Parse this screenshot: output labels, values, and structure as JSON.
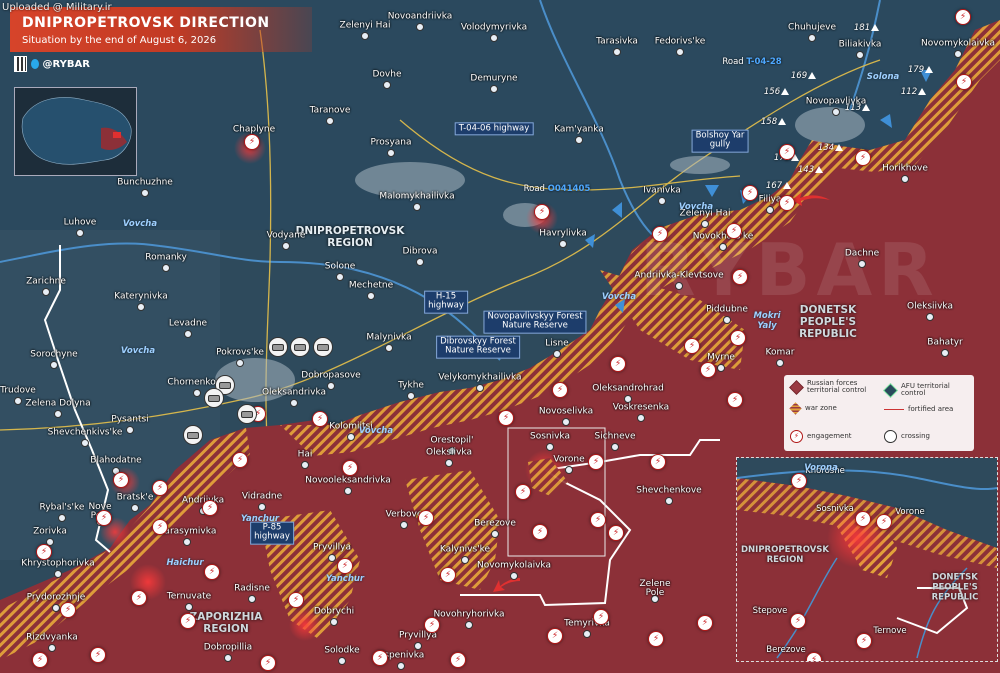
{
  "upload_note": "Uploaded @ Military.ir",
  "header": {
    "title": "DNIPROPETROVSK DIRECTION",
    "subtitle": "Situation by the end of August 6, 2026"
  },
  "brand": {
    "handle": "@RYBAR",
    "icons": [
      "qr-code-icon",
      "telegram-icon"
    ]
  },
  "colors": {
    "afu_territory": "#2e4a5c",
    "russian_territory": "#8c3038",
    "war_zone_stripe": "#e2a23a",
    "header_red": "#d6442a",
    "river": "#4a8ec9",
    "road_yellow": "#e7c14a",
    "engagement": "#c8181c"
  },
  "regions": [
    {
      "id": "dnipropetrovsk",
      "text": "DNIPROPETROVSK\nREGION"
    },
    {
      "id": "donetsk",
      "text": "DONETSK\nPEOPLE'S\nREPUBLIC"
    },
    {
      "id": "zaporizhia",
      "text": "ZAPORIZHIA\nREGION"
    }
  ],
  "settlements": [
    "Zelenyi Hai",
    "Novoandriivka",
    "Volodymyrivka",
    "Tarasivka",
    "Fedorivs'ke",
    "Chuhujeve",
    "Biliakivka",
    "Novomykolaivka",
    "Dovhe",
    "Demurynе",
    "Taranove",
    "Chaplyne",
    "Prosyana",
    "Kam'yanka",
    "Novopavlivka",
    "Bunchuzhne",
    "Malomykhailivka",
    "Ivanivka",
    "Filiya",
    "Horikhove",
    "Luhove",
    "Vodyane",
    "Havrylivka",
    "Zelenyi Hai",
    "Novokhats'ke",
    "Romanky",
    "Solone",
    "Dibrova",
    "Dachne",
    "Zarichne",
    "Mechetne",
    "Andriivka-Klevtsove",
    "Katerynivka",
    "Oleksiivka",
    "Levadne",
    "Piddubne",
    "Bahatyr",
    "Sorochyne",
    "Malynivka",
    "Pokrovs'ke",
    "Lisne",
    "Myrne",
    "Komar",
    "Trudove",
    "Chornenkove",
    "Dobropasove",
    "Velykomykhailivka",
    "Zelena Dolyna",
    "Oleksandrivka",
    "Tykhe",
    "Oleksandrohrad",
    "Pysantsi",
    "Kolomiitsi",
    "Orestopil'",
    "Novoselivka",
    "Voskresenka",
    "Shevchenkivs'ke",
    "Sosnivka",
    "Sichneve",
    "Hai",
    "Blahodatne",
    "Oleksiivka",
    "Vorone",
    "Novooleksandrivka",
    "Shevchenkove",
    "Bratsk'e",
    "Andriivka",
    "Vidradne",
    "Rybal's'ke",
    "Nove\nPole",
    "Verbove",
    "Berezove",
    "Harasymivka",
    "Zorivka",
    "Kalynivs'ke",
    "Pryvillya",
    "Khrystophorivka",
    "Novomykolaivka",
    "Radisne",
    "Ternuvate",
    "Zelene\nPole",
    "Prydorozhnje",
    "Dobrychi",
    "Novohryhorivka",
    "Temyrivka",
    "Rizdvyanka",
    "Pryvillya",
    "Dobropillia",
    "Solodke",
    "Uspenivka"
  ],
  "rivers": [
    "Vovcha",
    "Vovcha",
    "Vovcha",
    "Vovcha",
    "Vovcha",
    "Mokri\nYaly",
    "Yanchur",
    "Yanchur",
    "Haichur",
    "Solona",
    "Vorona"
  ],
  "roads": [
    {
      "prefix": "Road ",
      "code": "T-04-28"
    },
    {
      "prefix": "Road ",
      "code": "O041405"
    }
  ],
  "road_boxes": [
    "T-04-06 highway",
    "Bolshoy Yar\ngully",
    "H-15\nhighway",
    "P-85\nhighway"
  ],
  "forest_labels": [
    "Novopavlivskyy Forest\nNature Reserve",
    "Dibrovskyy Forest\nNature Reserve"
  ],
  "heights": [
    "181",
    "179",
    "169",
    "156",
    "112",
    "158",
    "113",
    "172",
    "134",
    "143",
    "167"
  ],
  "legend": {
    "items": [
      {
        "icon": "russian-control-swatch",
        "label": "Russian forces\nterritorial control"
      },
      {
        "icon": "afu-control-swatch",
        "label": "AFU territorial control"
      },
      {
        "icon": "war-zone-swatch",
        "label": "war zone"
      },
      {
        "icon": "fortified-area-line",
        "label": "fortified area"
      },
      {
        "icon": "engagement-icon",
        "label": "engagement"
      },
      {
        "icon": "crossing-icon",
        "label": "crossing"
      }
    ]
  },
  "inset": {
    "settlements": [
      "Khoroshe",
      "Sosnivka",
      "Vorone",
      "Stepove",
      "Ternove",
      "Berezove"
    ],
    "regions": [
      "DNIPROPETROVSK\nREGION",
      "DONETSK\nPEOPLE'S\nREPUBLIC"
    ],
    "river": "Vorona"
  },
  "watermark": "RYBAR"
}
